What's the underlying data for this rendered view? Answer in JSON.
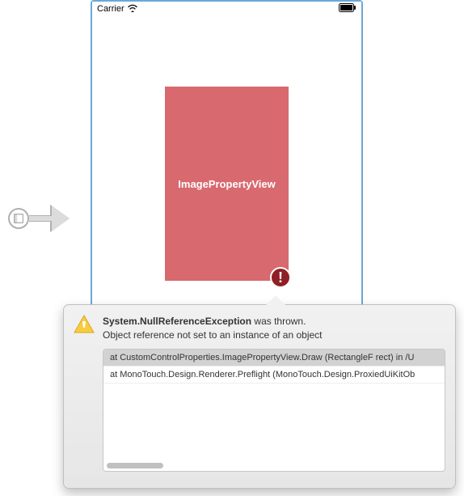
{
  "statusbar": {
    "carrier": "Carrier"
  },
  "view": {
    "label": "ImagePropertyView"
  },
  "error_badge": {
    "glyph": "!"
  },
  "popover": {
    "exception_name": "System.NullReferenceException",
    "thrown_suffix": " was thrown.",
    "message": "Object reference not set to an instance of an object",
    "stack": [
      "at CustomControlProperties.ImagePropertyView.Draw (RectangleF rect) in /U",
      "at MonoTouch.Design.Renderer.Preflight (MonoTouch.Design.ProxiedUiKitOb"
    ]
  }
}
